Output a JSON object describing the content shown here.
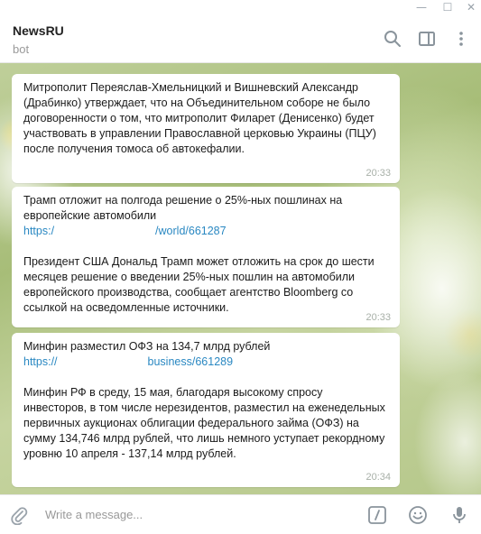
{
  "window": {
    "minimize_glyph": "—",
    "maximize_glyph": "☐",
    "close_glyph": "✕"
  },
  "header": {
    "title": "NewsRU",
    "subtitle": "bot",
    "icons": [
      "search-icon",
      "sidebar-toggle-icon",
      "more-vertical-icon"
    ]
  },
  "messages": [
    {
      "text": "Митрополит Переяслав-Хмельницкий и Вишневский Александр (Драбинко) утверждает, что на Объединительном соборе не было договоренности о том, что митрополит Филарет (Денисенко) будет участвовать в управлении Православной церковью Украины (ПЦУ) после получения томоса об автокефалии.",
      "time": "20:33"
    },
    {
      "headline": "Трамп отложит на полгода решение о 25%-ных пошлинах на европейские автомобили",
      "link_start": "https:/",
      "link_end": "/world/661287",
      "body": "Президент США Дональд Трамп может отложить на срок до шести месяцев решение о введении 25%-ных пошлин на автомобили европейского производства, сообщает агентство Bloomberg со ссылкой на осведомленные источники.",
      "time": "20:33"
    },
    {
      "headline": "Минфин разместил ОФЗ на 134,7 млрд рублей",
      "link_start": "https://",
      "link_end": "business/661289",
      "body": "Минфин РФ в среду, 15 мая, благодаря высокому спросу инвесторов, в том числе нерезидентов, разместил на еженедельных первичных аукционах облигации федерального займа (ОФЗ) на сумму 134,746 млрд рублей, что лишь немного уступает рекордному уровню 10 апреля - 137,14 млрд рублей.",
      "time": "20:34"
    }
  ],
  "composer": {
    "placeholder": "Write a message...",
    "icons": [
      "attach-icon",
      "commands-icon",
      "emoji-icon",
      "microphone-icon"
    ]
  },
  "colors": {
    "link": "#2a88c2",
    "accent_icons": "#9aa3ab"
  }
}
